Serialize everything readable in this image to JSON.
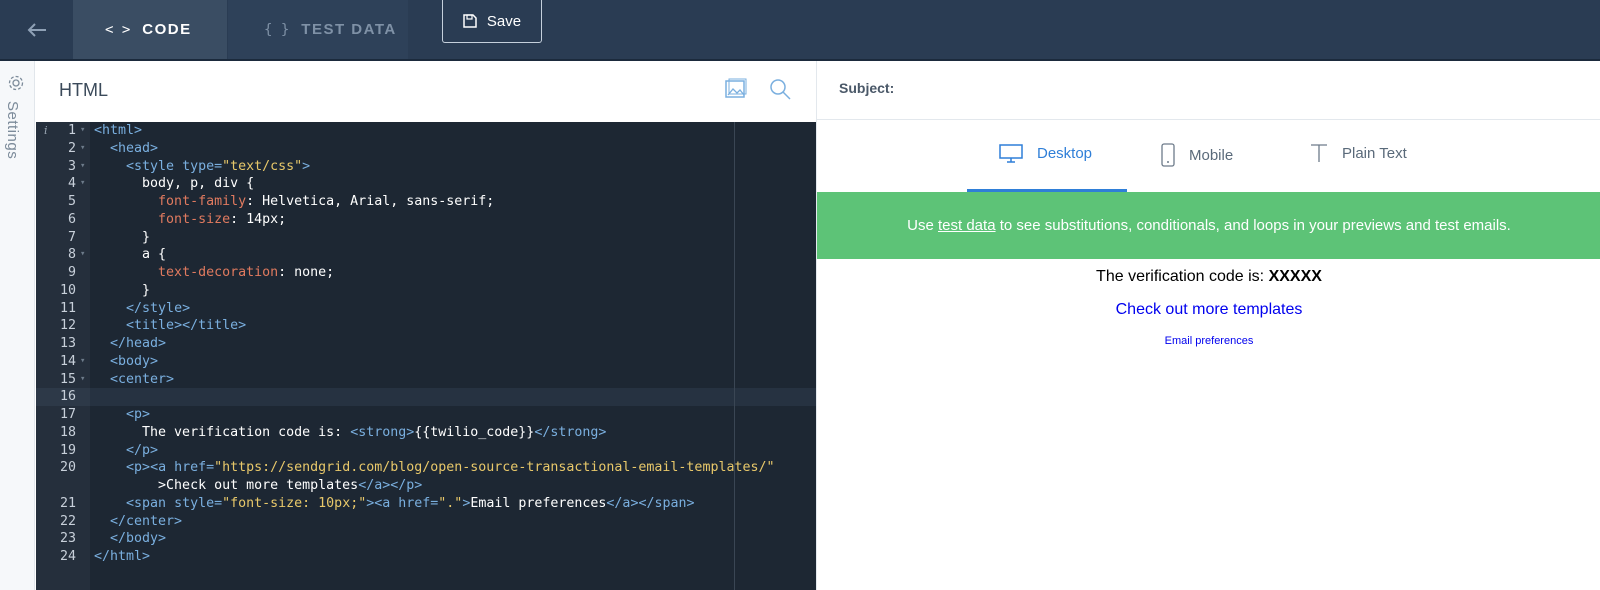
{
  "topbar": {
    "back_icon": "arrow-left-icon",
    "tabs": [
      {
        "glyph": "< >",
        "label": "CODE",
        "active": true
      },
      {
        "glyph": "{ }",
        "label": "TEST DATA",
        "active": false
      }
    ],
    "save_label": "Save",
    "save_icon": "floppy-disk-icon"
  },
  "rail": {
    "settings_label": "Settings",
    "icon": "gear-icon"
  },
  "editor": {
    "title": "HTML",
    "icons": [
      "image-icon",
      "search-icon"
    ],
    "lines": [
      {
        "n": "1",
        "code": "<html>"
      },
      {
        "n": "2",
        "code": "  <head>"
      },
      {
        "n": "3",
        "code": "    <style type=\"text/css\">"
      },
      {
        "n": "4",
        "code": "      body, p, div {"
      },
      {
        "n": "5",
        "code": "        font-family: Helvetica, Arial, sans-serif;"
      },
      {
        "n": "6",
        "code": "        font-size: 14px;"
      },
      {
        "n": "7",
        "code": "      }"
      },
      {
        "n": "8",
        "code": "      a {"
      },
      {
        "n": "9",
        "code": "        text-decoration: none;"
      },
      {
        "n": "10",
        "code": "      }"
      },
      {
        "n": "11",
        "code": "    </style>"
      },
      {
        "n": "12",
        "code": "    <title></title>"
      },
      {
        "n": "13",
        "code": "  </head>"
      },
      {
        "n": "14",
        "code": "  <body>"
      },
      {
        "n": "15",
        "code": "  <center>"
      },
      {
        "n": "16",
        "code": ""
      },
      {
        "n": "17",
        "code": "    <p>"
      },
      {
        "n": "18",
        "code": "      The verification code is: <strong>{{twilio_code}}</strong>"
      },
      {
        "n": "19",
        "code": "    </p>"
      },
      {
        "n": "20",
        "code": "    <p><a href=\"https://sendgrid.com/blog/open-source-transactional-email-templates/\""
      },
      {
        "n": "",
        "code": "        >Check out more templates</a></p>"
      },
      {
        "n": "21",
        "code": "    <span style=\"font-size: 10px;\"><a href=\".\">Email preferences</a></span>"
      },
      {
        "n": "22",
        "code": "  </center>"
      },
      {
        "n": "23",
        "code": "  </body>"
      },
      {
        "n": "24",
        "code": "</html>"
      }
    ]
  },
  "preview": {
    "subject_label": "Subject:",
    "tabs": [
      {
        "label": "Desktop",
        "icon": "monitor-icon",
        "active": true
      },
      {
        "label": "Mobile",
        "icon": "phone-icon",
        "active": false
      },
      {
        "label": "Plain Text",
        "icon": "text-t-icon",
        "active": false
      }
    ],
    "banner": {
      "prefix": "Use ",
      "link": "test data",
      "suffix": " to see substitutions, conditionals, and loops in your previews and test emails."
    },
    "email": {
      "verify_text": "The verification code is: ",
      "code": "XXXXX",
      "more_link": "Check out more templates",
      "prefs_link": "Email preferences"
    }
  },
  "colors": {
    "topbar": "#2a3c53",
    "editor_bg": "#1d2733",
    "accent": "#2f7fd8",
    "banner": "#5dc377"
  }
}
